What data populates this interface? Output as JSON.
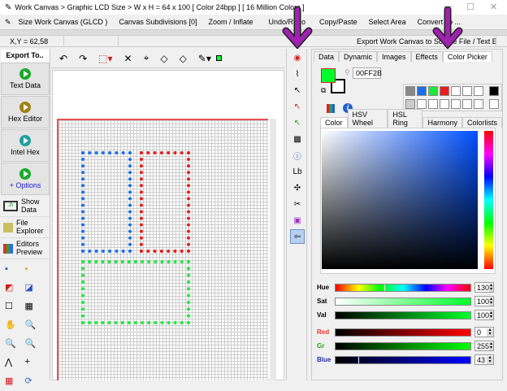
{
  "window": {
    "title": "Work Canvas > Graphic LCD Size > W x H = 64 x 100 [ Color 24bpp ] [ 16 Million Colors ]",
    "controls": [
      "—",
      "☐",
      "✕"
    ]
  },
  "menu": [
    "Size Work Canvas (GLCD )",
    "Canvas Subdivisions [0]",
    "Zoom / Inflate",
    "Undo/Redo",
    "Copy/Paste",
    "Select Area",
    "Convert To ..."
  ],
  "status": {
    "coords": "X,Y = 62,58",
    "export": "Export Work Canvas to Source File / Text Editor"
  },
  "left": {
    "header": "Export To..",
    "buttons": [
      {
        "label": "Text Data",
        "color": "#1aaa2a"
      },
      {
        "label": "Hex Editor",
        "color": "#a08010"
      },
      {
        "label": "Intel Hex",
        "color": "#20a0a0"
      },
      {
        "label": "+ Options",
        "color": "#1aaa2a"
      }
    ],
    "rows": [
      {
        "label1": "Show",
        "label2": "Data"
      },
      {
        "label1": "File",
        "label2": "Explorer"
      },
      {
        "label1": "Editors",
        "label2": "Preview"
      }
    ]
  },
  "canvas": {
    "shapes": [
      {
        "name": "blue",
        "color": "#1e6ee8"
      },
      {
        "name": "red",
        "color": "#e81e1e"
      },
      {
        "name": "green",
        "color": "#1ee83c"
      }
    ]
  },
  "right": {
    "tabs": [
      "Data",
      "Dynamic",
      "Images",
      "Effects",
      "Color Picker"
    ],
    "active_tab": "Color Picker",
    "hex_value": "00FF2B",
    "primary_color": "#00ff2b",
    "secondary_color": "#ffffff",
    "subtabs": [
      "Color",
      "HSV Wheel",
      "HSL Ring",
      "Harmony",
      "Colorlists"
    ],
    "sliders": [
      {
        "label": "Hue",
        "value": "130",
        "fraction": 0.36
      },
      {
        "label": "Sat",
        "value": "100",
        "fraction": 1
      },
      {
        "label": "Val",
        "value": "100",
        "fraction": 1
      },
      {
        "label": "Red",
        "value": "0",
        "fraction": 0
      },
      {
        "label": "Gr",
        "value": "255",
        "fraction": 1
      },
      {
        "label": "Blue",
        "value": "43",
        "fraction": 0.17
      }
    ]
  }
}
